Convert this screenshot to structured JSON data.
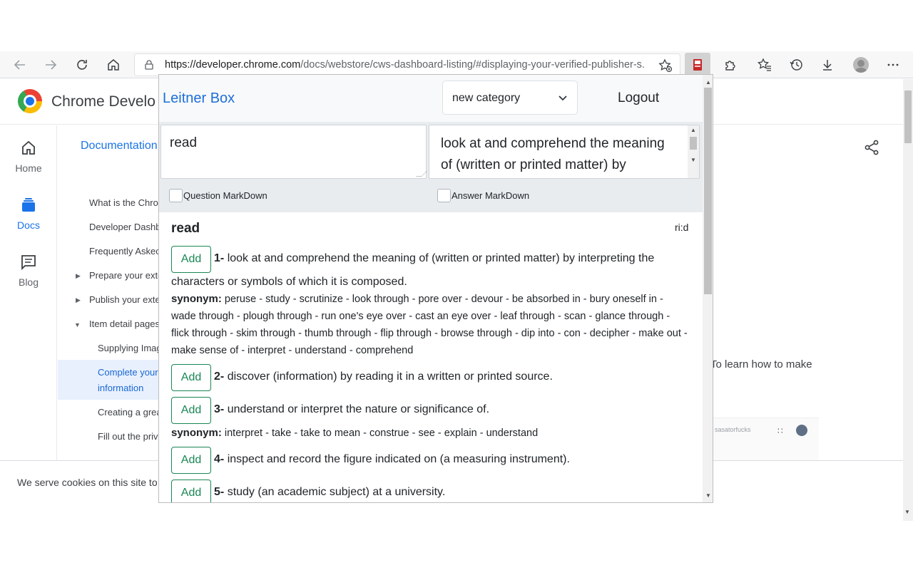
{
  "browser": {
    "url_host": "https://developer.chrome.com",
    "url_path": "/docs/webstore/cws-dashboard-listing/#displaying-your-verified-publisher-s..."
  },
  "page": {
    "site_title": "Chrome Develo",
    "rail": [
      {
        "label": "Home",
        "icon": "home-icon"
      },
      {
        "label": "Docs",
        "icon": "docs-icon"
      },
      {
        "label": "Blog",
        "icon": "blog-icon"
      }
    ],
    "documentation_link": "Documentation",
    "nav": [
      {
        "label": "What is the Chro"
      },
      {
        "label": "Developer Dashb"
      },
      {
        "label": "Frequently Askec"
      },
      {
        "label": "Prepare your exte"
      },
      {
        "label": "Publish your exte"
      },
      {
        "label": "Item detail pages"
      },
      {
        "label": "Supplying Imag"
      },
      {
        "label": "Complete your"
      },
      {
        "label": "information"
      },
      {
        "label": "Creating a grea"
      },
      {
        "label": "Fill out the priv"
      }
    ],
    "body_text": "To learn how to make",
    "mini_shot_text": "sasatorfucks",
    "cookie_text": "We serve cookies on this site to"
  },
  "popup": {
    "brand": "Leitner Box",
    "category": "new category",
    "logout": "Logout",
    "question": "read",
    "answer": "look at and comprehend the meaning of (written or printed matter) by interpreting",
    "question_markdown": "Question MarkDown",
    "answer_markdown": "Answer MarkDown",
    "word": "read",
    "phonetic": "ri:d",
    "add_label": "Add",
    "synonym_label": "synonym:",
    "definitions": [
      {
        "num": "1-",
        "text": "look at and comprehend the meaning of (written or printed matter) by interpreting the characters or symbols of which it is composed.",
        "synonyms": "peruse - study - scrutinize - look through - pore over - devour - be absorbed in - bury oneself in - wade through - plough through - run one's eye over - cast an eye over - leaf through - scan - glance through - flick through - skim through - thumb through - flip through - browse through - dip into - con - decipher - make out - make sense of - interpret - understand - comprehend"
      },
      {
        "num": "2-",
        "text": "discover (information) by reading it in a written or printed source."
      },
      {
        "num": "3-",
        "text": "understand or interpret the nature or significance of.",
        "synonyms": "interpret - take - take to mean - construe - see - explain - understand"
      },
      {
        "num": "4-",
        "text": "inspect and record the figure indicated on (a measuring instrument)."
      },
      {
        "num": "5-",
        "text": "study (an academic subject) at a university."
      }
    ]
  }
}
